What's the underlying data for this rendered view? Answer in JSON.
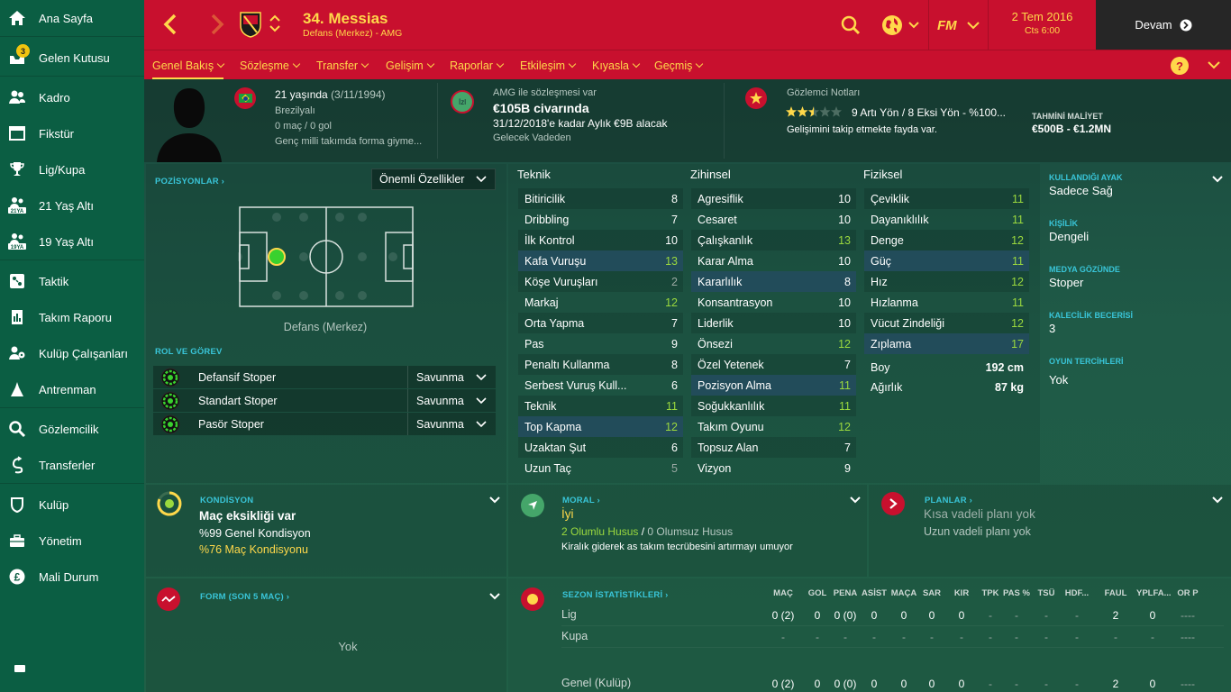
{
  "sidebar": {
    "items": [
      {
        "label": "Ana Sayfa",
        "icon": "home-icon"
      },
      {
        "label": "Gelen Kutusu",
        "icon": "inbox-icon",
        "badge": "3"
      },
      {
        "label": "Kadro",
        "icon": "squad-icon"
      },
      {
        "label": "Fikstür",
        "icon": "calendar-icon"
      },
      {
        "label": "Lig/Kupa",
        "icon": "trophy-icon"
      },
      {
        "label": "21 Yaş Altı",
        "icon": "u21-icon"
      },
      {
        "label": "19 Yaş Altı",
        "icon": "u19-icon"
      },
      {
        "label": "Taktik",
        "icon": "tactics-icon"
      },
      {
        "label": "Takım Raporu",
        "icon": "report-icon"
      },
      {
        "label": "Kulüp Çalışanları",
        "icon": "staff-icon"
      },
      {
        "label": "Antrenman",
        "icon": "training-icon"
      },
      {
        "label": "Gözlemcilik",
        "icon": "scouting-icon"
      },
      {
        "label": "Transferler",
        "icon": "transfers-icon"
      },
      {
        "label": "Kulüp",
        "icon": "club-icon"
      },
      {
        "label": "Yönetim",
        "icon": "board-icon"
      },
      {
        "label": "Mali Durum",
        "icon": "finances-icon"
      }
    ]
  },
  "header": {
    "player_name": "34. Messias",
    "subtitle": "Defans (Merkez) - AMG",
    "date": "2 Tem 2016",
    "time": "Cts 6:00",
    "continue_label": "Devam",
    "fm_label": "FM"
  },
  "tabs": [
    {
      "label": "Genel Bakış",
      "active": true
    },
    {
      "label": "Sözleşme"
    },
    {
      "label": "Transfer"
    },
    {
      "label": "Gelişim"
    },
    {
      "label": "Raporlar"
    },
    {
      "label": "Etkileşim"
    },
    {
      "label": "Kıyasla"
    },
    {
      "label": "Geçmiş"
    }
  ],
  "profile": {
    "age": "21 yaşında",
    "dob": "(3/11/1994)",
    "nationality": "Brezilyalı",
    "caps": "0 maç / 0 gol",
    "youth": "Genç milli takımda forma giyme...",
    "contract_label": "AMG ile sözleşmesi var",
    "value": "€105B civarında",
    "wage": "31/12/2018'e kadar Aylık €9B alacak",
    "status": "Gelecek Vadeden",
    "status_badge": "İzl",
    "scout_title": "Gözlemci Notları",
    "stars_filled": 2.5,
    "stars_total": 5,
    "scout_note": "9 Artı Yön / 8 Eksi Yön - %100...",
    "scout_text": "Gelişimini takip etmekte fayda var.",
    "cost_label": "TAHMİNİ MALİYET",
    "cost_value": "€500B - €1.2MN"
  },
  "positions": {
    "header": "POZİSYONLAR",
    "dropdown": "Önemli Özellikler",
    "position_name": "Defans (Merkez)",
    "role_header": "ROL VE GÖREV",
    "roles": [
      {
        "name": "Defansif Stoper",
        "duty": "Savunma"
      },
      {
        "name": "Standart Stoper",
        "duty": "Savunma"
      },
      {
        "name": "Pasör Stoper",
        "duty": "Savunma"
      }
    ]
  },
  "attributes": {
    "technical_title": "Teknik",
    "mental_title": "Zihinsel",
    "physical_title": "Fiziksel",
    "technical": [
      {
        "n": "Bitiricilik",
        "v": "8"
      },
      {
        "n": "Dribbling",
        "v": "7"
      },
      {
        "n": "İlk Kontrol",
        "v": "10"
      },
      {
        "n": "Kafa Vuruşu",
        "v": "13"
      },
      {
        "n": "Köşe Vuruşları",
        "v": "2"
      },
      {
        "n": "Markaj",
        "v": "12"
      },
      {
        "n": "Orta Yapma",
        "v": "7"
      },
      {
        "n": "Pas",
        "v": "9"
      },
      {
        "n": "Penaltı Kullanma",
        "v": "8"
      },
      {
        "n": "Serbest Vuruş Kull...",
        "v": "6"
      },
      {
        "n": "Teknik",
        "v": "11"
      },
      {
        "n": "Top Kapma",
        "v": "12"
      },
      {
        "n": "Uzaktan Şut",
        "v": "6"
      },
      {
        "n": "Uzun Taç",
        "v": "5"
      }
    ],
    "mental": [
      {
        "n": "Agresiflik",
        "v": "10"
      },
      {
        "n": "Cesaret",
        "v": "10"
      },
      {
        "n": "Çalışkanlık",
        "v": "13"
      },
      {
        "n": "Karar Alma",
        "v": "10"
      },
      {
        "n": "Kararlılık",
        "v": "8"
      },
      {
        "n": "Konsantrasyon",
        "v": "10"
      },
      {
        "n": "Liderlik",
        "v": "10"
      },
      {
        "n": "Önsezi",
        "v": "12"
      },
      {
        "n": "Özel Yetenek",
        "v": "7"
      },
      {
        "n": "Pozisyon Alma",
        "v": "11"
      },
      {
        "n": "Soğukkanlılık",
        "v": "11"
      },
      {
        "n": "Takım Oyunu",
        "v": "12"
      },
      {
        "n": "Topsuz Alan",
        "v": "7"
      },
      {
        "n": "Vizyon",
        "v": "9"
      }
    ],
    "physical": [
      {
        "n": "Çeviklik",
        "v": "11"
      },
      {
        "n": "Dayanıklılık",
        "v": "11"
      },
      {
        "n": "Denge",
        "v": "12"
      },
      {
        "n": "Güç",
        "v": "11"
      },
      {
        "n": "Hız",
        "v": "12"
      },
      {
        "n": "Hızlanma",
        "v": "11"
      },
      {
        "n": "Vücut Zindeliği",
        "v": "12"
      },
      {
        "n": "Zıplama",
        "v": "17"
      }
    ],
    "height_label": "Boy",
    "height": "192 cm",
    "weight_label": "Ağırlık",
    "weight": "87 kg"
  },
  "info": {
    "foot_label": "KULLANDIĞI AYAK",
    "foot": "Sadece Sağ",
    "personality_label": "KİŞİLİK",
    "personality": "Dengeli",
    "media_label": "MEDYA GÖZÜNDE",
    "media": "Stoper",
    "gk_label": "KALECİLİK BECERİSİ",
    "gk": "3",
    "prefs_label": "OYUN TERCİHLERİ",
    "prefs": "Yok"
  },
  "condition": {
    "header": "KONDİSYON",
    "title": "Maç eksikliği var",
    "general": "%99 Genel Kondisyon",
    "match": "%76 Maç Kondisyonu"
  },
  "morale": {
    "header": "MORAL",
    "value": "İyi",
    "positive": "2 Olumlu Husus",
    "sep": "/",
    "negative": "0 Olumsuz Husus",
    "note": "Kiralık giderek as takım tecrübesini artırmayı umuyor"
  },
  "plans": {
    "header": "PLANLAR",
    "short": "Kısa vadeli planı yok",
    "long": "Uzun vadeli planı yok"
  },
  "form": {
    "header": "FORM (SON 5 MAÇ)",
    "value": "Yok"
  },
  "stats": {
    "header": "SEZON İSTATİSTİKLERİ",
    "columns": [
      "MAÇ",
      "GOL",
      "PENA",
      "ASİST",
      "MAÇA",
      "SAR",
      "KIR",
      "TPK",
      "PAS %",
      "TSÜ",
      "HDF...",
      "FAUL",
      "YPLFA...",
      "OR P"
    ],
    "rows": [
      {
        "label": "Lig",
        "values": [
          "0 (2)",
          "0",
          "0 (0)",
          "0",
          "0",
          "0",
          "0",
          "-",
          "-",
          "-",
          "-",
          "2",
          "0",
          "----"
        ]
      },
      {
        "label": "Kupa",
        "values": [
          "-",
          "-",
          "-",
          "-",
          "-",
          "-",
          "-",
          "-",
          "-",
          "-",
          "-",
          "-",
          "-",
          "----"
        ]
      },
      {
        "label": "Genel (Kulüp)",
        "values": [
          "0 (2)",
          "0",
          "0 (0)",
          "0",
          "0",
          "0",
          "0",
          "-",
          "-",
          "-",
          "-",
          "2",
          "0",
          "----"
        ]
      }
    ]
  }
}
